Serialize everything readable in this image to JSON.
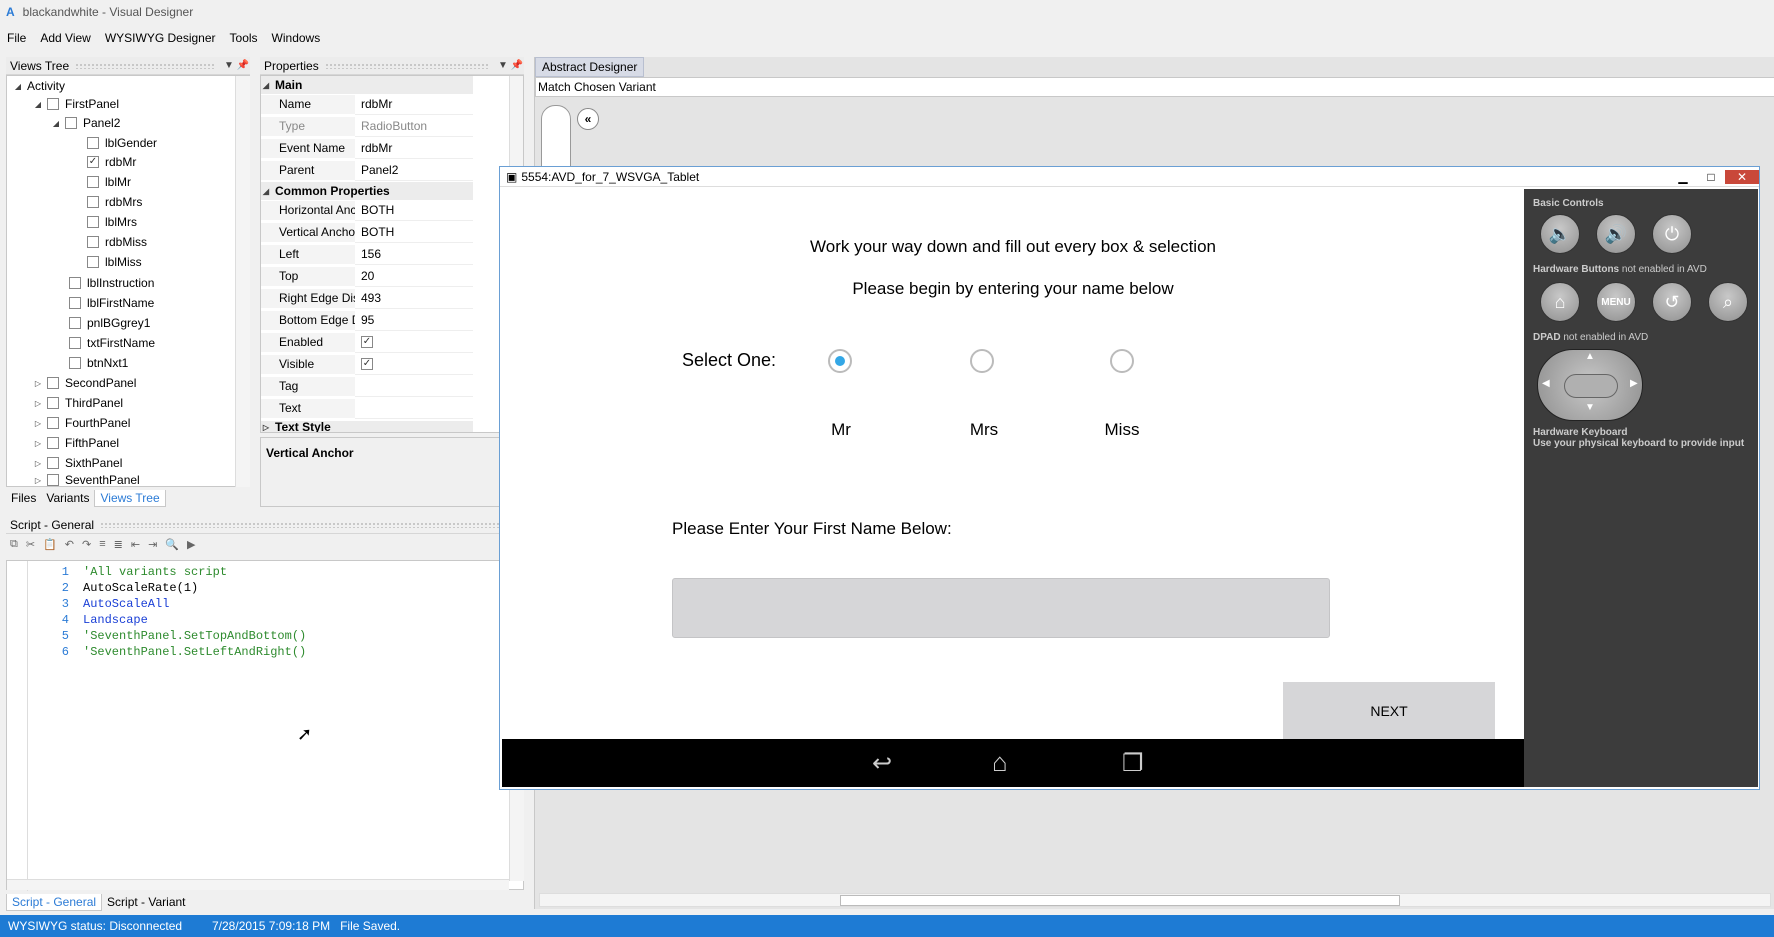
{
  "window": {
    "app_icon": "A",
    "title": "blackandwhite - Visual Designer"
  },
  "menu": [
    "File",
    "Add View",
    "WYSIWYG Designer",
    "Tools",
    "Windows"
  ],
  "views_tree": {
    "title": "Views Tree",
    "items": [
      "Activity",
      "FirstPanel",
      "Panel2",
      "lblGender",
      "rdbMr",
      "lblMr",
      "rdbMrs",
      "lblMrs",
      "rdbMiss",
      "lblMiss",
      "lblInstruction",
      "lblFirstName",
      "pnlBGgrey1",
      "txtFirstName",
      "btnNxt1",
      "SecondPanel",
      "ThirdPanel",
      "FourthPanel",
      "FifthPanel",
      "SixthPanel",
      "SeventhPanel"
    ],
    "tabs": [
      "Files",
      "Variants",
      "Views Tree"
    ]
  },
  "properties": {
    "title": "Properties",
    "section_main": "Main",
    "main": [
      {
        "k": "Name",
        "v": "rdbMr"
      },
      {
        "k": "Type",
        "v": "RadioButton"
      },
      {
        "k": "Event Name",
        "v": "rdbMr"
      },
      {
        "k": "Parent",
        "v": "Panel2"
      }
    ],
    "section_common": "Common Properties",
    "common": [
      {
        "k": "Horizontal Anchor",
        "v": "BOTH"
      },
      {
        "k": "Vertical Anchor",
        "v": "BOTH"
      },
      {
        "k": "Left",
        "v": "156"
      },
      {
        "k": "Top",
        "v": "20"
      },
      {
        "k": "Right Edge Distanc",
        "v": "493"
      },
      {
        "k": "Bottom Edge Dista",
        "v": "95"
      },
      {
        "k": "Enabled",
        "v": "✓"
      },
      {
        "k": "Visible",
        "v": "✓"
      },
      {
        "k": "Tag",
        "v": ""
      },
      {
        "k": "Text",
        "v": ""
      }
    ],
    "section_partial": "Text Style",
    "description": "Vertical Anchor"
  },
  "script": {
    "title": "Script - General",
    "lines": [
      {
        "n": "1",
        "t": "'All variants script",
        "c": "#2e8b2e"
      },
      {
        "n": "2",
        "t": "AutoScaleRate(1)",
        "c": "#000000"
      },
      {
        "n": "3",
        "t": "AutoScaleAll",
        "c": "#1a3fd6"
      },
      {
        "n": "4",
        "t": "Landscape",
        "c": "#1a3fd6"
      },
      {
        "n": "5",
        "t": "'SeventhPanel.SetTopAndBottom()",
        "c": "#2e8b2e"
      },
      {
        "n": "6",
        "t": "'SeventhPanel.SetLeftAndRight()",
        "c": "#2e8b2e"
      }
    ],
    "tabs": [
      "Script - General",
      "Script - Variant"
    ]
  },
  "abstract_designer": {
    "tab": "Abstract Designer",
    "variant": "Match Chosen Variant"
  },
  "emulator": {
    "title": "5554:AVD_for_7_WSVGA_Tablet",
    "line1": "Work your way down and fill out every box & selection",
    "line2": "Please begin by entering your name below",
    "select_label": "Select One:",
    "options": [
      "Mr",
      "Mrs",
      "Miss"
    ],
    "selected_index": 0,
    "first_name_label": "Please Enter Your First Name Below:",
    "first_name_value": "",
    "next_label": "NEXT",
    "side": {
      "basic_controls": "Basic Controls",
      "hw_buttons": "Hardware Buttons",
      "hw_note": "not enabled in AVD",
      "menu": "MENU",
      "dpad": "DPAD",
      "dpad_note": "not enabled in AVD",
      "keyboard": "Hardware Keyboard",
      "keyboard_note": "Use your physical keyboard to provide input"
    }
  },
  "status": {
    "wysiwyg": "WYSIWYG status: Disconnected",
    "saved": "7/28/2015 7:09:18 PM   File Saved."
  },
  "colors": {
    "accent": "#1e7bd4",
    "radio_selected": "#33a7e6",
    "emu_side": "#3c3c3c",
    "nav_bar": "#000000"
  }
}
